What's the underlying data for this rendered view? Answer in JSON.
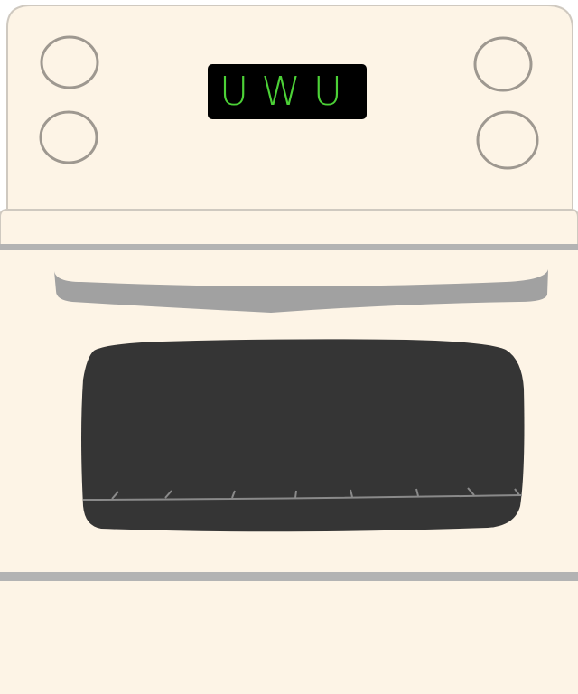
{
  "display": {
    "text": "UWU",
    "text_color": "#4cd137",
    "background_color": "#000000"
  },
  "colors": {
    "body": "#fdf4e6",
    "outline": "#cfc9c0",
    "knob_outline": "#9e9890",
    "handle": "#a1a1a1",
    "trim": "#b3b3b3",
    "window": "#353535",
    "window_rack": "#8a8a8a"
  },
  "controls": {
    "knobs": [
      "knob-top-left",
      "knob-bottom-left",
      "knob-top-right",
      "knob-bottom-right"
    ]
  },
  "oven": {
    "door": "oven-door",
    "handle": "oven-handle",
    "window": "oven-window"
  }
}
